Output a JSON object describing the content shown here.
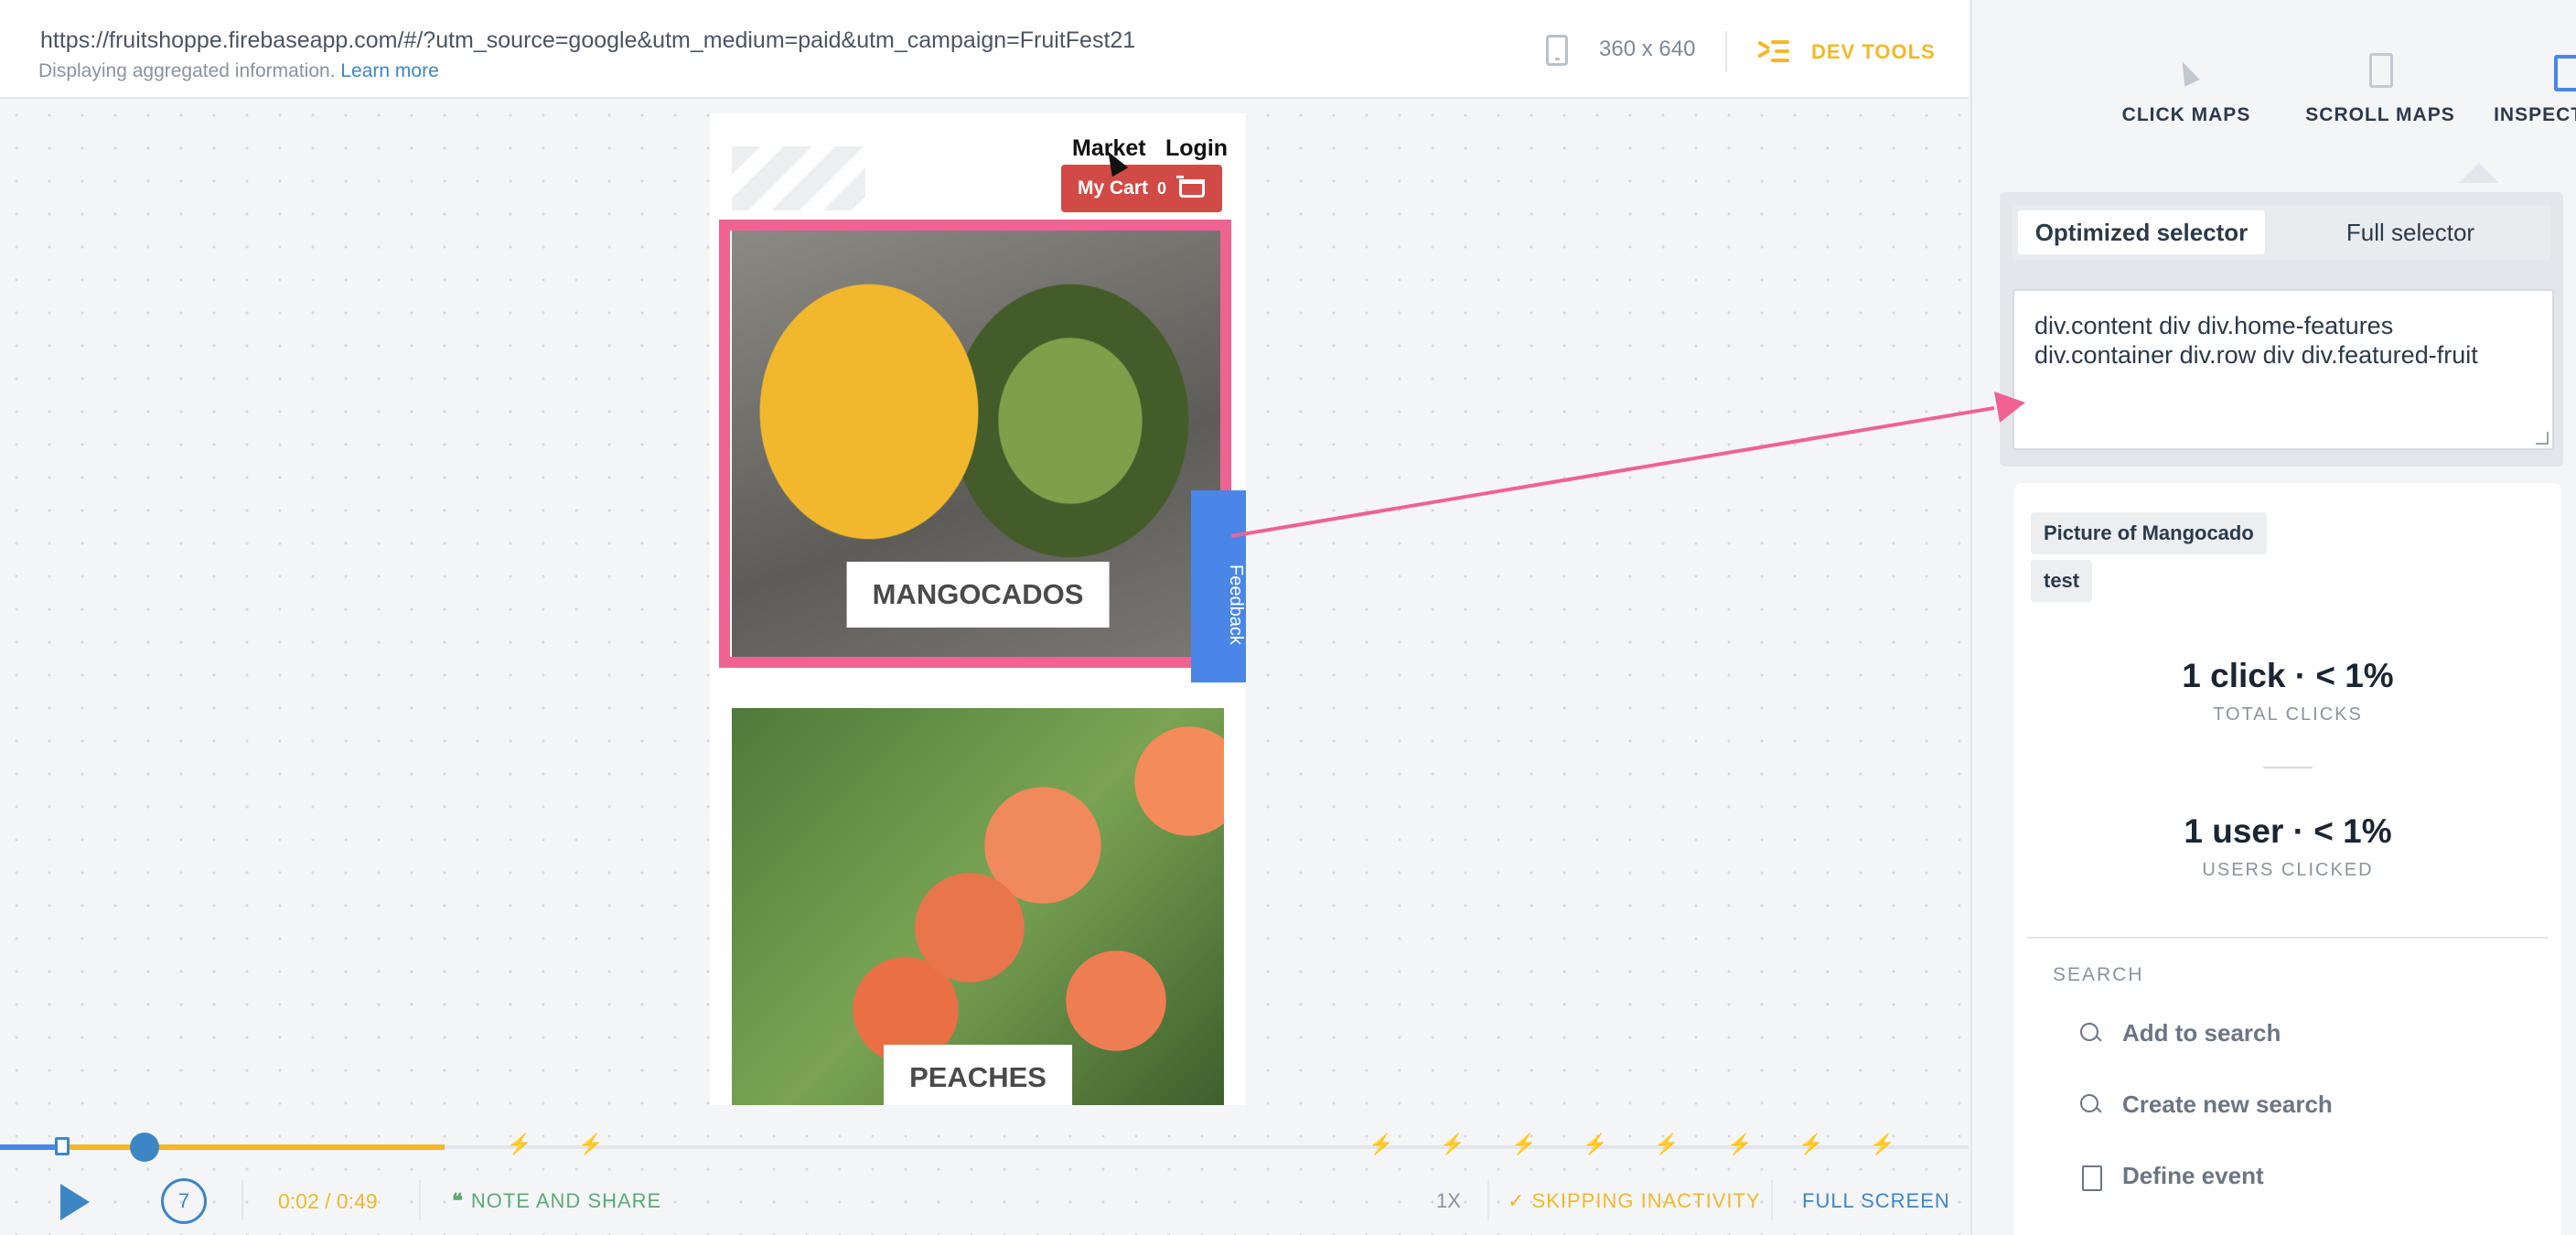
{
  "header": {
    "url": "https://fruitshoppe.firebaseapp.com/#/?utm_source=google&utm_medium=paid&utm_campaign=FruitFest21",
    "subinfo": "Displaying aggregated information.",
    "learn_more": "Learn more",
    "device_size": "360 x 640",
    "dev_tools": "DEV TOOLS"
  },
  "site": {
    "nav_market": "Market",
    "nav_login": "Login",
    "cart_label": "My Cart",
    "cart_count": "0",
    "fruits": [
      {
        "label": "MANGOCADOS"
      },
      {
        "label": "PEACHES"
      }
    ],
    "feedback": "Feedback"
  },
  "playback": {
    "time": "0:02 / 0:49",
    "skip_seconds": "7",
    "note_and_share": "NOTE AND SHARE",
    "speed": "1X",
    "skipping": "SKIPPING INACTIVITY",
    "full_screen": "FULL SCREEN",
    "progress_fraction": 0.226
  },
  "panel": {
    "modes": [
      {
        "label": "CLICK MAPS",
        "icon": "click-maps-icon"
      },
      {
        "label": "SCROLL MAPS",
        "icon": "scroll-maps-icon"
      },
      {
        "label": "INSPECT MODE",
        "icon": "inspect-mode-icon",
        "active": true
      }
    ],
    "selector_tabs": {
      "optimized": "Optimized selector",
      "full": "Full selector"
    },
    "selector_text": "div.content div div.home-features div.container div.row div div.featured-fruit",
    "tags": [
      "Picture of Mangocado",
      "test"
    ],
    "clicks_value": "1 click · < 1%",
    "clicks_label": "TOTAL CLICKS",
    "users_value": "1 user · < 1%",
    "users_label": "USERS CLICKED",
    "search_heading": "SEARCH",
    "actions": {
      "add": "Add to search",
      "new": "Create new search",
      "define": "Define event"
    }
  },
  "colors": {
    "accent_blue": "#3d86c6",
    "highlight_pink": "#f06292",
    "playback_yellow": "#f0b929",
    "cart_red": "#d24a45"
  }
}
